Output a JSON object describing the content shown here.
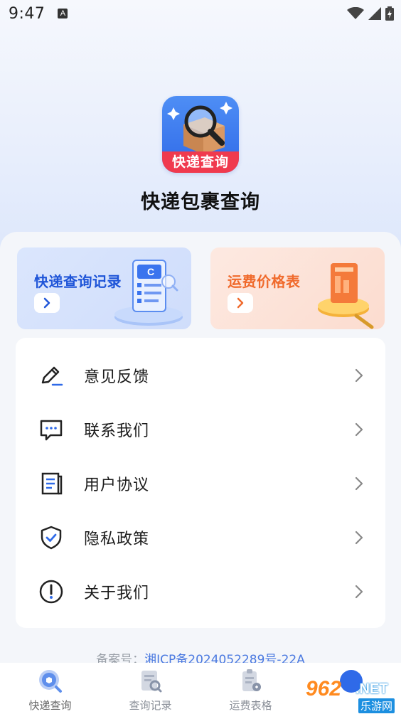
{
  "status_bar": {
    "time": "9:47",
    "a_badge": "A"
  },
  "app": {
    "icon_banner": "快递查询",
    "title": "快递包裹查询"
  },
  "cards": [
    {
      "title": "快递查询记录",
      "accent": "#1f55d8"
    },
    {
      "title": "运费价格表",
      "accent": "#f06a2c"
    }
  ],
  "menu": [
    {
      "label": "意见反馈",
      "icon": "edit-icon"
    },
    {
      "label": "联系我们",
      "icon": "chat-icon"
    },
    {
      "label": "用户协议",
      "icon": "document-icon"
    },
    {
      "label": "隐私政策",
      "icon": "shield-check-icon"
    },
    {
      "label": "关于我们",
      "icon": "info-icon"
    }
  ],
  "icp": {
    "prefix": "备案号：",
    "number": "湘ICP备2024052289号-22A"
  },
  "tabs": [
    {
      "label": "快递查询",
      "icon": "package-search-icon"
    },
    {
      "label": "查询记录",
      "icon": "record-icon"
    },
    {
      "label": "运费表格",
      "icon": "fee-table-icon"
    },
    {
      "label": "",
      "icon": "profile-icon"
    }
  ],
  "watermark": {
    "number": "962",
    "net": ".NET",
    "cn": "乐游网"
  }
}
